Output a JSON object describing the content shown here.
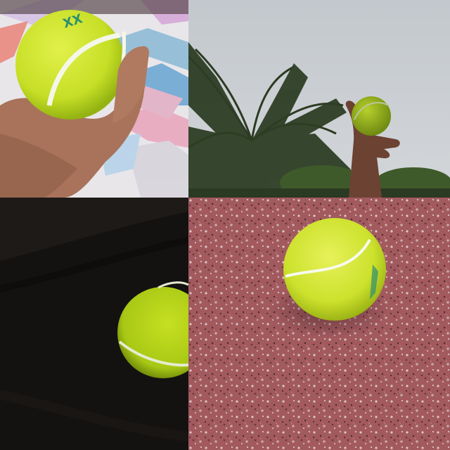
{
  "collage": {
    "panels": [
      {
        "id": "hand-on-bedsheet",
        "ball_print": "XX"
      },
      {
        "id": "ball-raised-toward-sky",
        "ball_print": ""
      },
      {
        "id": "ball-on-dark-cloth",
        "ball_print": ""
      },
      {
        "id": "ball-on-granite",
        "ball_print": ""
      }
    ]
  },
  "colors": {
    "ball": "#c8e12a",
    "ball_shade": "#8fae10",
    "seam": "#f2f6e6",
    "print": "#2f8f6f",
    "sky": "#c9cdd1",
    "granite": "#9e5a5e",
    "cloth": "#141210",
    "skin": "#9c6a52"
  }
}
